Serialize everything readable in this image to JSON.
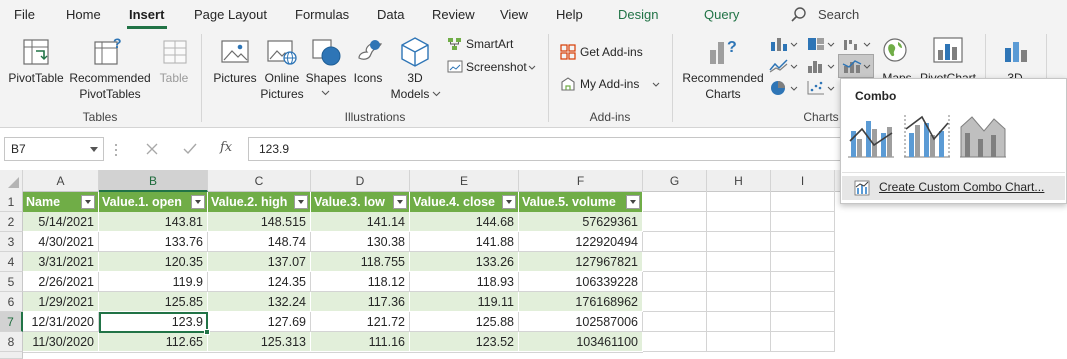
{
  "menu": {
    "tabs": [
      {
        "label": "File"
      },
      {
        "label": "Home"
      },
      {
        "label": "Insert"
      },
      {
        "label": "Page Layout"
      },
      {
        "label": "Formulas"
      },
      {
        "label": "Data"
      },
      {
        "label": "Review"
      },
      {
        "label": "View"
      },
      {
        "label": "Help"
      },
      {
        "label": "Design"
      },
      {
        "label": "Query"
      }
    ],
    "active_tab": "Insert",
    "search_label": "Search"
  },
  "ribbon": {
    "tables": {
      "pivot_table": "PivotTable",
      "recommended_line1": "Recommended",
      "recommended_line2": "PivotTables",
      "table": "Table",
      "group_label": "Tables"
    },
    "illustrations": {
      "pictures": "Pictures",
      "online_line1": "Online",
      "online_line2": "Pictures",
      "shapes": "Shapes",
      "icons": "Icons",
      "models_line1": "3D",
      "models_line2": "Models",
      "smartart": "SmartArt",
      "screenshot": "Screenshot",
      "group_label": "Illustrations"
    },
    "addins": {
      "get": "Get Add-ins",
      "my": "My Add-ins",
      "group_label": "Add-ins"
    },
    "charts": {
      "rec_line1": "Recommended",
      "rec_line2": "Charts",
      "maps": "Maps",
      "pivotchart": "PivotChart",
      "three_d": "3D",
      "group_label": "Charts"
    }
  },
  "formula_bar": {
    "name_box": "B7",
    "fx": "fx",
    "value": "123.9"
  },
  "grid": {
    "columns": [
      "A",
      "B",
      "C",
      "D",
      "E",
      "F",
      "G",
      "H",
      "I"
    ],
    "selected_column": "B",
    "headers": [
      "Name",
      "Value.1. open",
      "Value.2. high",
      "Value.3. low",
      "Value.4. close",
      "Value.5. volume"
    ],
    "rows": [
      {
        "num": "1"
      },
      {
        "num": "2",
        "cells": [
          "5/14/2021",
          "143.81",
          "148.515",
          "141.14",
          "144.68",
          "57629361"
        ]
      },
      {
        "num": "3",
        "cells": [
          "4/30/2021",
          "133.76",
          "148.74",
          "130.38",
          "141.88",
          "122920494"
        ]
      },
      {
        "num": "4",
        "cells": [
          "3/31/2021",
          "120.35",
          "137.07",
          "118.755",
          "133.26",
          "127967821"
        ]
      },
      {
        "num": "5",
        "cells": [
          "2/26/2021",
          "119.9",
          "124.35",
          "118.12",
          "118.93",
          "106339228"
        ]
      },
      {
        "num": "6",
        "cells": [
          "1/29/2021",
          "125.85",
          "132.24",
          "117.36",
          "119.11",
          "176168962"
        ]
      },
      {
        "num": "7",
        "cells": [
          "12/31/2020",
          "123.9",
          "127.69",
          "121.72",
          "125.88",
          "102587006"
        ]
      },
      {
        "num": "8",
        "cells": [
          "11/30/2020",
          "112.65",
          "125.313",
          "111.16",
          "123.52",
          "103461100"
        ]
      }
    ],
    "selected_row": "7"
  },
  "combo_menu": {
    "title": "Combo",
    "custom": "Create Custom Combo Chart..."
  },
  "colors": {
    "accent": "#217346",
    "table_header": "#70ad47",
    "band": "#e2efda",
    "chart_blue": "#5b9bd5"
  }
}
